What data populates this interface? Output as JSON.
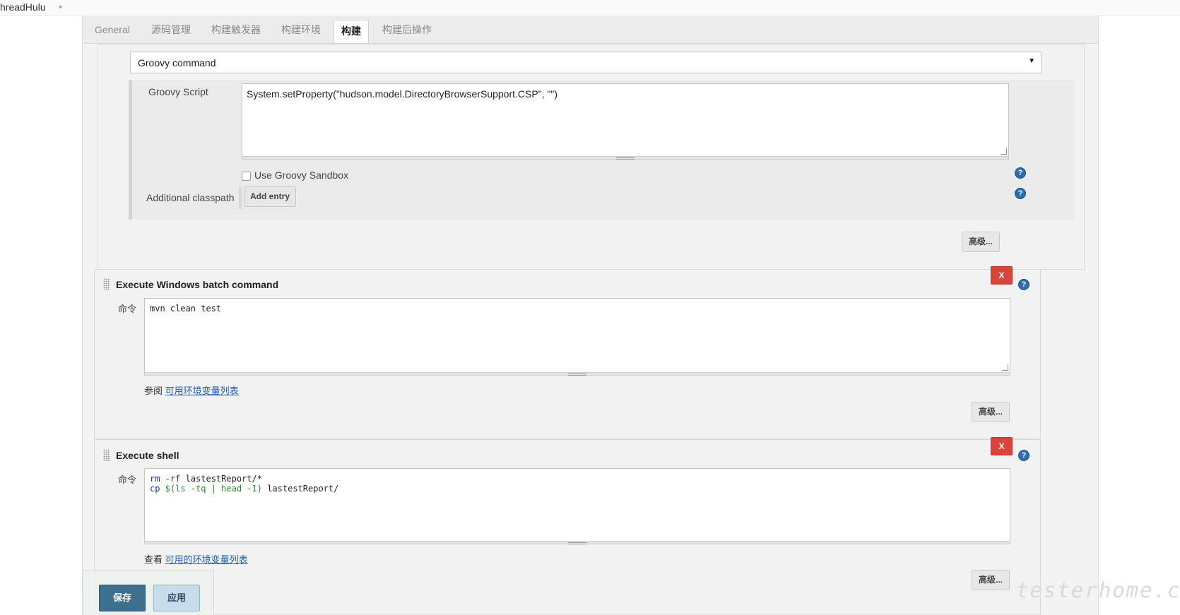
{
  "breadcrumb": {
    "project": "hreadHulu",
    "arrow": "▸"
  },
  "tabs": [
    {
      "label": "General",
      "active": false
    },
    {
      "label": "源码管理",
      "active": false
    },
    {
      "label": "构建触发器",
      "active": false
    },
    {
      "label": "构建环境",
      "active": false
    },
    {
      "label": "构建",
      "active": true
    },
    {
      "label": "构建后操作",
      "active": false
    }
  ],
  "groovy_step": {
    "select_value": "Groovy command",
    "script_label": "Groovy Script",
    "script_value": "System.setProperty(\"hudson.model.DirectoryBrowserSupport.CSP\", \"\")",
    "sandbox_label": "Use Groovy Sandbox",
    "sandbox_checked": false,
    "classpath_label": "Additional classpath",
    "add_entry_label": "Add entry",
    "advanced_label": "高级..."
  },
  "windows_step": {
    "title": "Execute Windows batch command",
    "delete_label": "X",
    "command_label": "命令",
    "command_value": "mvn clean test",
    "see_prefix": "参阅",
    "env_link": "可用环境变量列表",
    "advanced_label": "高级..."
  },
  "shell_step": {
    "title": "Execute shell",
    "delete_label": "X",
    "command_label": "命令",
    "command_lines": [
      "rm -rf lastestReport/*",
      "cp $(ls -tq | head -1) lastestReport/"
    ],
    "see_prefix": "查看",
    "env_link": "可用的环境变量列表",
    "advanced_label": "高级..."
  },
  "help_icon_text": "?",
  "footer": {
    "save_label": "保存",
    "apply_label": "应用"
  },
  "watermark": "testerhome.com",
  "colors": {
    "delete": "#d9453b",
    "save": "#3e6f8c",
    "link": "#1f5fb5",
    "help": "#2a6ead"
  }
}
